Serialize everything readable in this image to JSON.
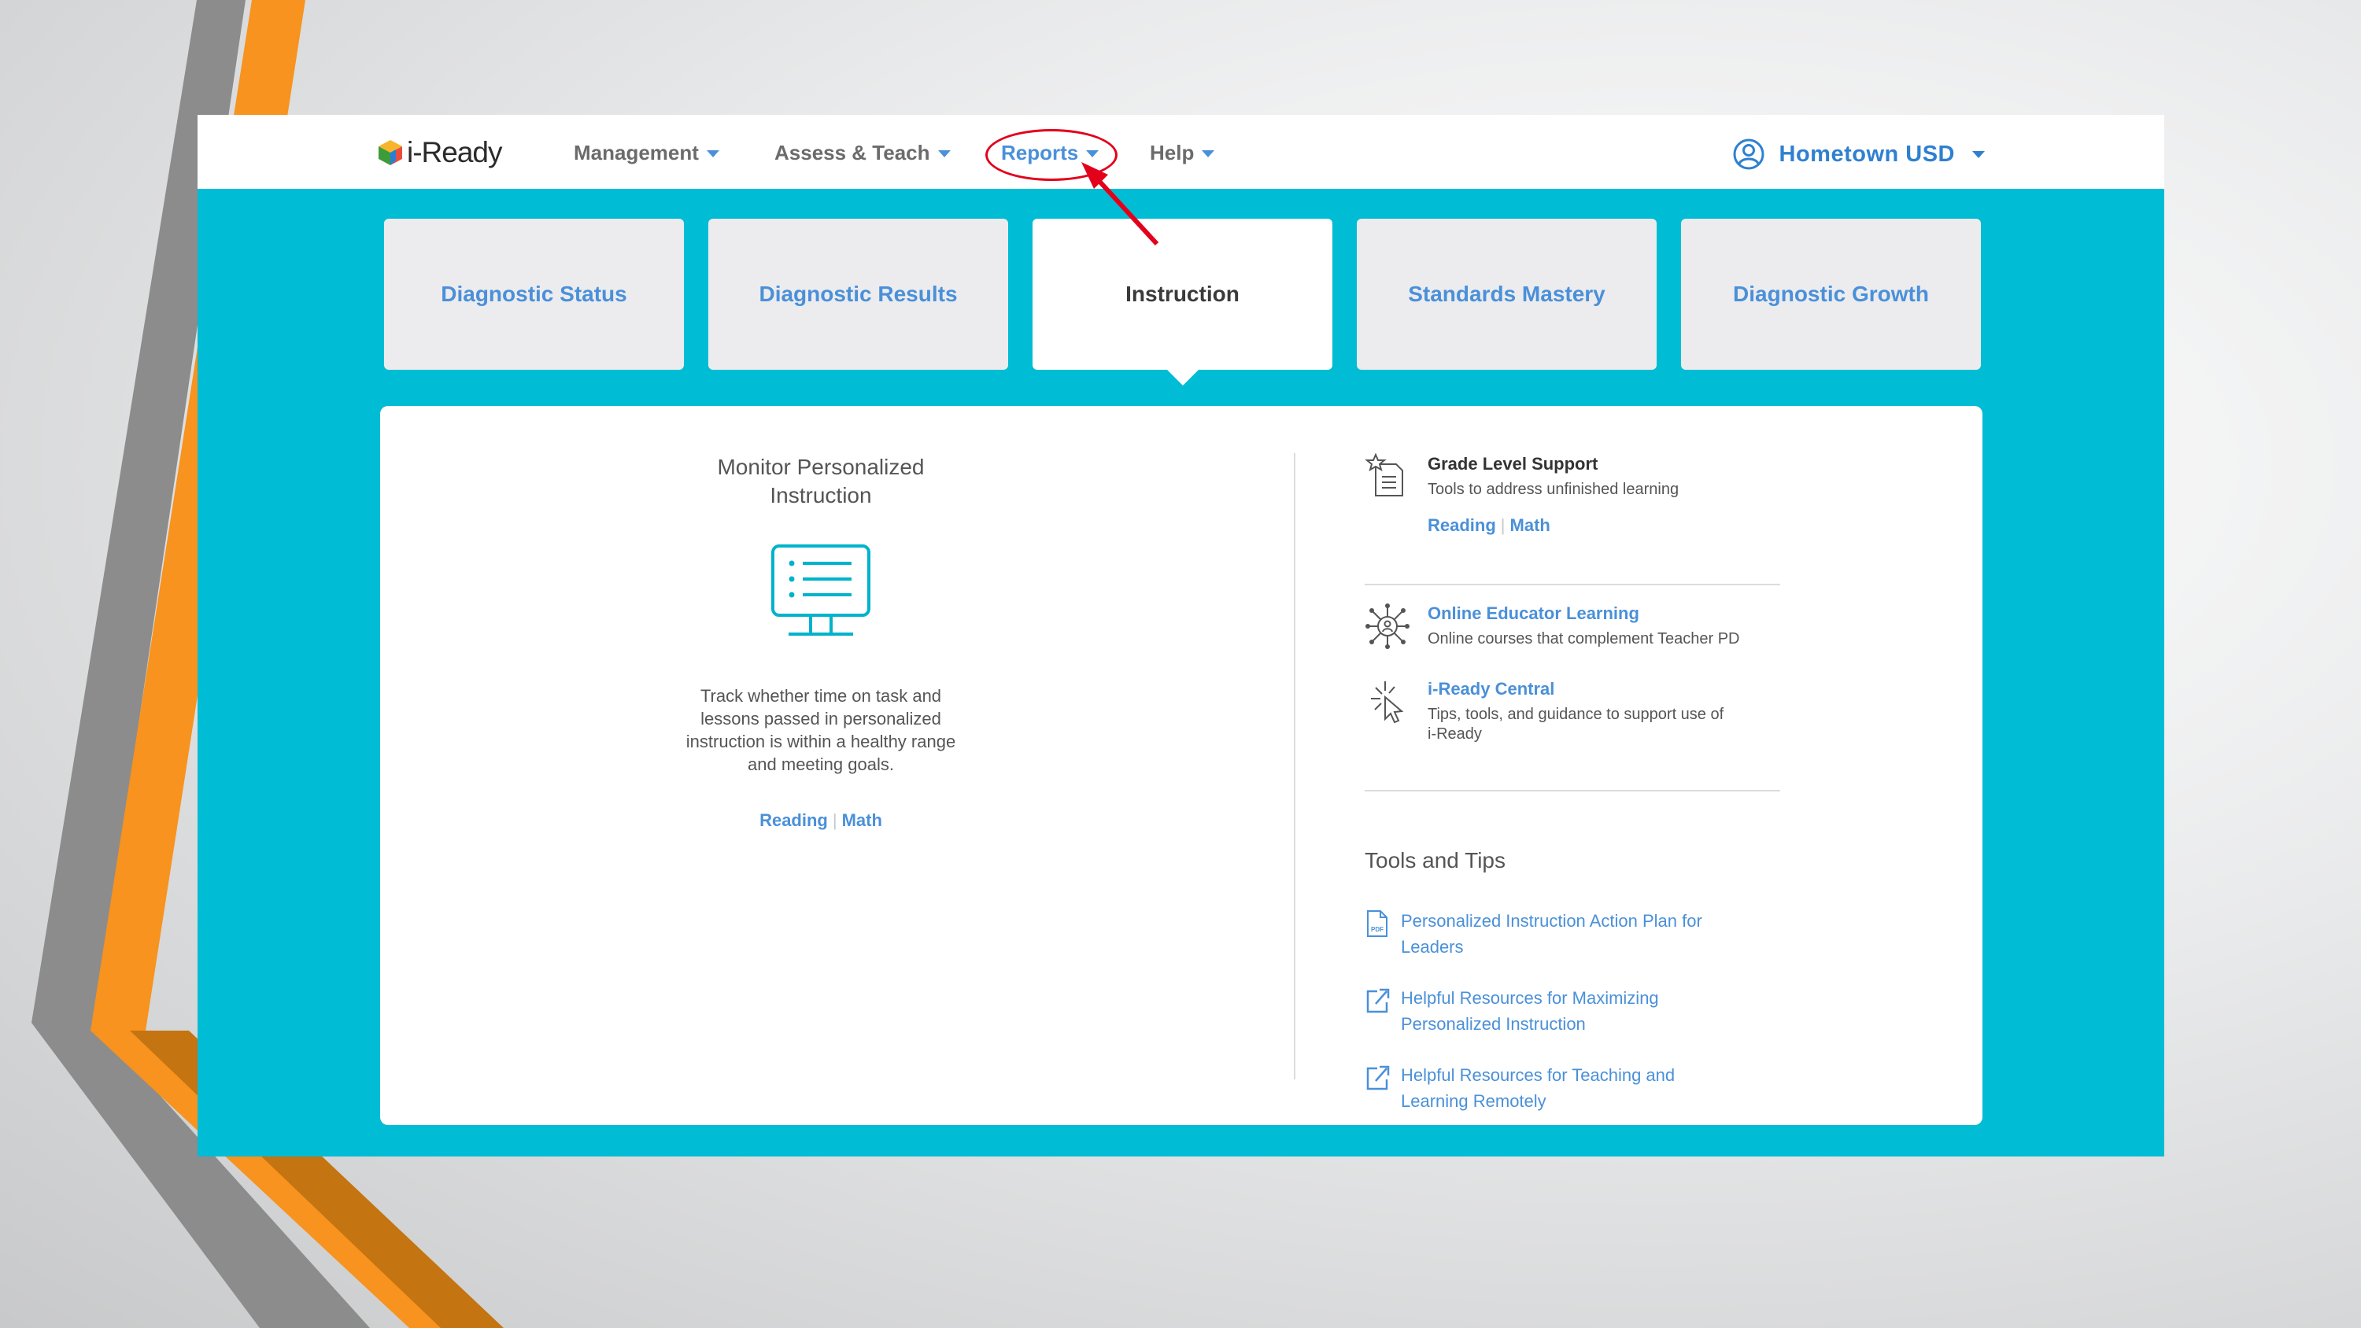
{
  "app": {
    "logo_text": "i-Ready"
  },
  "nav": {
    "items": [
      {
        "label": "Management"
      },
      {
        "label": "Assess & Teach"
      },
      {
        "label": "Reports"
      },
      {
        "label": "Help"
      }
    ],
    "active": "Reports",
    "account_name": "Hometown USD"
  },
  "tiles": [
    {
      "label": "Diagnostic Status"
    },
    {
      "label": "Diagnostic Results"
    },
    {
      "label": "Instruction"
    },
    {
      "label": "Standards Mastery"
    },
    {
      "label": "Diagnostic Growth"
    }
  ],
  "selected_tile": "Instruction",
  "left": {
    "title_line1": "Monitor Personalized",
    "title_line2": "Instruction",
    "desc_line1": "Track whether time on task and",
    "desc_line2": "lessons passed in personalized",
    "desc_line3": "instruction is within a healthy range",
    "desc_line4": "and meeting goals.",
    "link_reading": "Reading",
    "link_math": "Math",
    "link_separator": "|"
  },
  "right": {
    "grade_level": {
      "title": "Grade Level Support",
      "desc": "Tools to address unfinished learning",
      "link_reading": "Reading",
      "link_math": "Math"
    },
    "educator_learning": {
      "title": "Online Educator Learning",
      "desc": "Online courses that complement Teacher PD"
    },
    "central": {
      "title": "i-Ready Central",
      "desc_line1": "Tips, tools, and guidance to support use of",
      "desc_line2": "i-Ready"
    },
    "tools_title": "Tools and Tips",
    "tools": [
      {
        "icon": "pdf-icon",
        "line1": "Personalized Instruction Action Plan for",
        "line2": "Leaders"
      },
      {
        "icon": "external-link-icon",
        "line1": "Helpful Resources for Maximizing",
        "line2": "Personalized Instruction"
      },
      {
        "icon": "external-link-icon",
        "line1": "Helpful Resources for Teaching and",
        "line2": "Learning Remotely"
      }
    ]
  },
  "colors": {
    "teal_background": "#00bcd4",
    "link_blue": "#4a90d9",
    "annotation_red": "#e3001b",
    "deco_orange": "#f7931e",
    "deco_gray": "#8c8c8c"
  }
}
